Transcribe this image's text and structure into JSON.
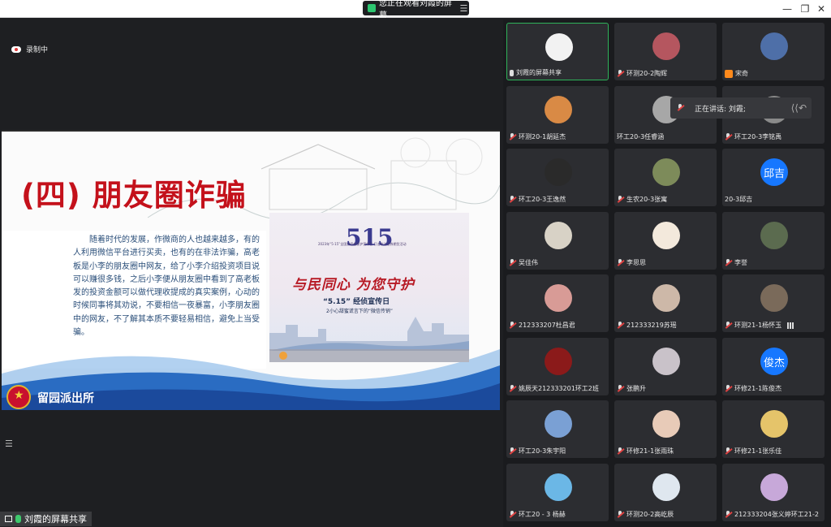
{
  "titlebar": {
    "share_banner": "您正在观看刘霞的屏幕",
    "menu_glyph": "☰",
    "minimize": "—",
    "restore": "❐",
    "close": "✕"
  },
  "stage": {
    "recording_label": "录制中",
    "presenter_label": "刘霞的屏幕共享"
  },
  "slide": {
    "title": "(四) 朋友圈诈骗",
    "body": "随着时代的发展，作微商的人也越来越多，有的人利用微信平台进行买卖，也有的在非法诈骗，高老板是小李的朋友圈中网友，给了小李介绍投资项目说可以赚很多钱，之后小李便从朋友圈中看到了高老板发的投资金额可以做代理收提成的真实案例，心动的时候同事将其劝说，不要相信一夜暴富，小李朋友圈中的网友，不了解其本质不要轻易相信，避免上当受骗。",
    "footer": "留园派出所",
    "video": {
      "logo": "515",
      "small_text": "2023年“5·15”全国投资者保护宣传日 打击非法证券期货活动",
      "slogan": "与民同心 为您守护",
      "day": "“5.15” 经侦宣传日",
      "sub": "2小心甜蜜谎言下的“微信传销”"
    }
  },
  "speaking": "正在讲话: 刘霞;",
  "participants": [
    {
      "name": "刘霞的屏幕共享",
      "avatar": "#f2f2f2",
      "mic": "on",
      "active": true
    },
    {
      "name": "环测20-2陶辉",
      "avatar": "#b5565f",
      "mic": "off"
    },
    {
      "name": "宋奇",
      "avatar": "#4e6fa8",
      "mic": "badge"
    },
    {
      "name": "环测20-1胡延杰",
      "avatar": "#d98a45",
      "mic": "off"
    },
    {
      "name": "环工20-3任睿涵",
      "avatar": "#a7a7a7",
      "mic": "none"
    },
    {
      "name": "环工20-3李铭禹",
      "avatar": "#8a8a8a",
      "mic": "off"
    },
    {
      "name": "环工20-3王逸然",
      "avatar": "#2a2a2a",
      "mic": "off"
    },
    {
      "name": "生农20-3张寓",
      "avatar": "#7d8b5a",
      "mic": "off"
    },
    {
      "name": "20-3邱吉",
      "avatar_text": "邱吉",
      "mic": "none"
    },
    {
      "name": "吴佳伟",
      "avatar": "#d8d2c6",
      "mic": "off"
    },
    {
      "name": "李思思",
      "avatar": "#f3e9dc",
      "mic": "off"
    },
    {
      "name": "李誉",
      "avatar": "#5b6b4f",
      "mic": "off"
    },
    {
      "name": "212333207杜昌君",
      "avatar": "#d89b96",
      "mic": "off"
    },
    {
      "name": "212333219苏瑶",
      "avatar": "#cdb8a8",
      "mic": "off"
    },
    {
      "name": "环测21-1杨怀玉",
      "avatar": "#7a6a5a",
      "mic": "off",
      "signal": true
    },
    {
      "name": "姚辰天212333201环工2班",
      "avatar": "#8b1a1a",
      "mic": "off"
    },
    {
      "name": "张鹏升",
      "avatar": "#c9c2c9",
      "mic": "off"
    },
    {
      "name": "环修21-1陈俊杰",
      "avatar_text": "俊杰",
      "mic": "off"
    },
    {
      "name": "环工20-3朱宇阳",
      "avatar": "#7aa0d4",
      "mic": "off"
    },
    {
      "name": "环修21-1张雨珠",
      "avatar": "#e8cbb8",
      "mic": "off"
    },
    {
      "name": "环修21-1张乐佳",
      "avatar": "#e5c46a",
      "mic": "off"
    },
    {
      "name": "环工20 - 3 杨赫",
      "avatar": "#6bb7e6",
      "mic": "off"
    },
    {
      "name": "环测20-2高屹辰",
      "avatar": "#dfe7ef",
      "mic": "off"
    },
    {
      "name": "212333204张义婷环工21-2",
      "avatar": "#c7a8d9",
      "mic": "off"
    }
  ]
}
